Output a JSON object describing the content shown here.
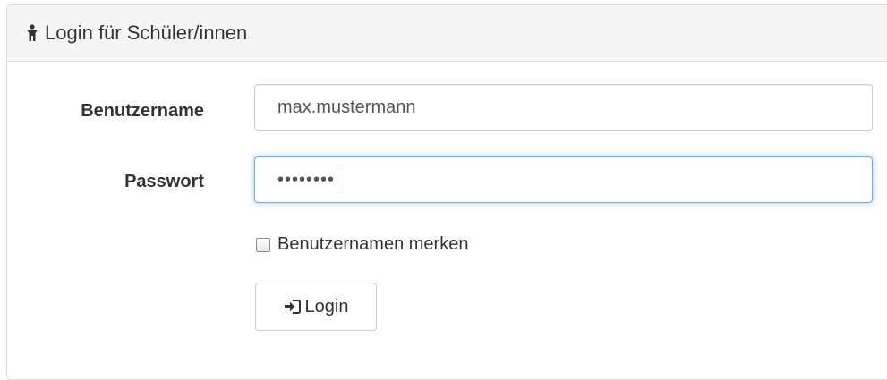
{
  "panel": {
    "title": "Login für Schüler/innen",
    "title_icon": "user-icon"
  },
  "form": {
    "username_label": "Benutzername",
    "username_value": "max.mustermann",
    "password_label": "Passwort",
    "password_value": "••••••••",
    "remember_label": "Benutzernamen merken",
    "remember_checked": false,
    "login_label": "Login",
    "login_icon": "sign-in-icon"
  },
  "colors": {
    "heading_bg": "#f5f5f5",
    "border": "#dddddd",
    "focus_border": "#66afe9",
    "text": "#333333"
  }
}
